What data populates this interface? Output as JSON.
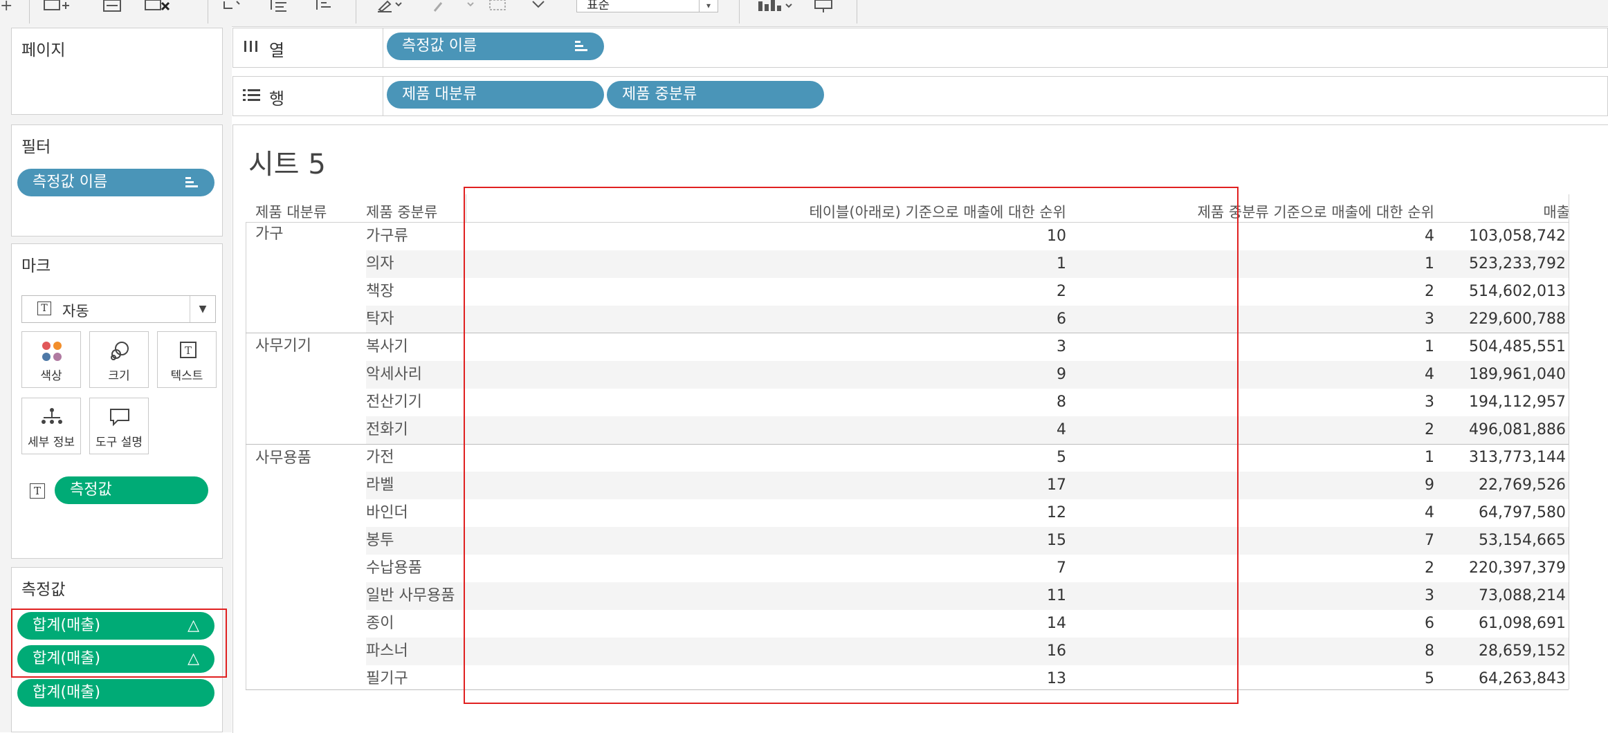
{
  "toolbar": {
    "format_select": "표준"
  },
  "pages_panel": {
    "title": "페이지"
  },
  "filters_panel": {
    "title": "필터",
    "pill": "측정값 이름"
  },
  "marks_panel": {
    "title": "마크",
    "mark_type": "자동",
    "buttons": [
      "색상",
      "크기",
      "텍스트",
      "세부 정보",
      "도구 설명"
    ],
    "text_pill": "측정값"
  },
  "measures_panel": {
    "title": "측정값",
    "pills": [
      "합계(매출)",
      "합계(매출)",
      "합계(매출)"
    ]
  },
  "columns_shelf": {
    "label": "열",
    "pills": [
      "측정값 이름"
    ]
  },
  "rows_shelf": {
    "label": "행",
    "pills": [
      "제품 대분류",
      "제품 중분류"
    ]
  },
  "sheet": {
    "title": "시트 5",
    "headers": [
      "제품 대분류",
      "제품 중분류",
      "테이블(아래로) 기준으로 매출에 대한 순위",
      "제품 중분류 기준으로 매출에 대한 순위",
      "매출"
    ],
    "groups": [
      "가구",
      "사무기기",
      "사무용품"
    ],
    "rows": [
      {
        "sub": "가구류",
        "rank_table": "10",
        "rank_sub": "4",
        "sales": "103,058,742"
      },
      {
        "sub": "의자",
        "rank_table": "1",
        "rank_sub": "1",
        "sales": "523,233,792"
      },
      {
        "sub": "책장",
        "rank_table": "2",
        "rank_sub": "2",
        "sales": "514,602,013"
      },
      {
        "sub": "탁자",
        "rank_table": "6",
        "rank_sub": "3",
        "sales": "229,600,788"
      },
      {
        "sub": "복사기",
        "rank_table": "3",
        "rank_sub": "1",
        "sales": "504,485,551"
      },
      {
        "sub": "악세사리",
        "rank_table": "9",
        "rank_sub": "4",
        "sales": "189,961,040"
      },
      {
        "sub": "전산기기",
        "rank_table": "8",
        "rank_sub": "3",
        "sales": "194,112,957"
      },
      {
        "sub": "전화기",
        "rank_table": "4",
        "rank_sub": "2",
        "sales": "496,081,886"
      },
      {
        "sub": "가전",
        "rank_table": "5",
        "rank_sub": "1",
        "sales": "313,773,144"
      },
      {
        "sub": "라벨",
        "rank_table": "17",
        "rank_sub": "9",
        "sales": "22,769,526"
      },
      {
        "sub": "바인더",
        "rank_table": "12",
        "rank_sub": "4",
        "sales": "64,797,580"
      },
      {
        "sub": "봉투",
        "rank_table": "15",
        "rank_sub": "7",
        "sales": "53,154,665"
      },
      {
        "sub": "수납용품",
        "rank_table": "7",
        "rank_sub": "2",
        "sales": "220,397,379"
      },
      {
        "sub": "일반 사무용품",
        "rank_table": "11",
        "rank_sub": "3",
        "sales": "73,088,214"
      },
      {
        "sub": "종이",
        "rank_table": "14",
        "rank_sub": "6",
        "sales": "61,098,691"
      },
      {
        "sub": "파스너",
        "rank_table": "16",
        "rank_sub": "8",
        "sales": "28,659,152"
      },
      {
        "sub": "필기구",
        "rank_table": "13",
        "rank_sub": "5",
        "sales": "64,263,843"
      }
    ]
  },
  "colors": {
    "blue_pill": "#4a95b8",
    "green_pill": "#00ab76",
    "highlight": "#e02020"
  }
}
